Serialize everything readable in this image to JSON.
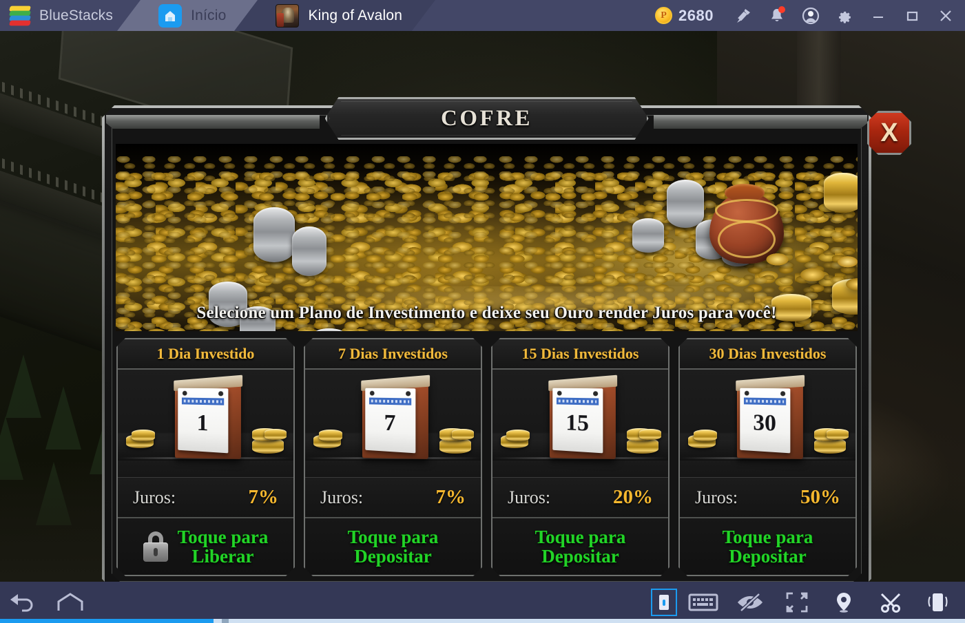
{
  "window": {
    "tabs": [
      {
        "label": "BlueStacks",
        "icon": "bluestacks-logo-icon"
      },
      {
        "label": "Início",
        "icon": "home-app-icon"
      },
      {
        "label": "King of Avalon",
        "icon": "game-app-icon"
      }
    ],
    "points": {
      "value": "2680",
      "icon": "points-coin-icon"
    },
    "controls": [
      {
        "name": "pin-broadcast-icon"
      },
      {
        "name": "notifications-bell-icon"
      },
      {
        "name": "user-account-icon"
      },
      {
        "name": "settings-gear-icon"
      },
      {
        "name": "minimize-icon"
      },
      {
        "name": "maximize-icon"
      },
      {
        "name": "close-icon"
      }
    ]
  },
  "dialog": {
    "title": "COFRE",
    "close_label": "X",
    "caption": "Selecione um Plano de Investimento e deixe seu Ouro render Juros para você!",
    "rate_label": "Juros:",
    "cards": [
      {
        "header": "1 Dia Investido",
        "calendar_number": "1",
        "rate_label": "Juros:",
        "rate_value": "7%",
        "action": "Toque para\nLiberar",
        "locked": true
      },
      {
        "header": "7 Dias Investidos",
        "calendar_number": "7",
        "rate_label": "Juros:",
        "rate_value": "7%",
        "action": "Toque para\nDepositar",
        "locked": false
      },
      {
        "header": "15 Dias Investidos",
        "calendar_number": "15",
        "rate_label": "Juros:",
        "rate_value": "20%",
        "action": "Toque para\nDepositar",
        "locked": false
      },
      {
        "header": "30 Dias Investidos",
        "calendar_number": "30",
        "rate_label": "Juros:",
        "rate_value": "50%",
        "action": "Toque para\nDepositar",
        "locked": false
      }
    ]
  },
  "bottombar": {
    "left": [
      {
        "name": "android-back-icon"
      },
      {
        "name": "android-home-icon"
      }
    ],
    "right": [
      {
        "name": "tap-control-icon"
      },
      {
        "name": "keyboard-controls-icon"
      },
      {
        "name": "hide-overlay-eye-icon"
      },
      {
        "name": "fullscreen-expand-icon"
      },
      {
        "name": "location-pin-icon"
      },
      {
        "name": "screenshot-scissors-icon"
      },
      {
        "name": "shake-device-icon"
      }
    ]
  },
  "colors": {
    "accent_blue": "#1b9bf0",
    "gold": "#f0b93c",
    "green": "#22d427",
    "red": "#a8260f",
    "chrome": "#434767"
  }
}
